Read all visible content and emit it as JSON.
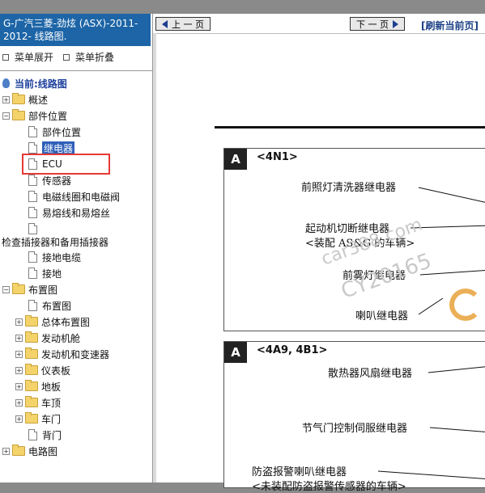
{
  "left_panel": {
    "title": "G-广汽三菱-劲炫 (ASX)-2011-2012- 线路图.",
    "expand_label": "菜单展开",
    "collapse_label": "菜单折叠",
    "current_label": "当前:线路图",
    "tree": {
      "n1": "概述",
      "n2": "部件位置",
      "n3": "部件位置",
      "n4": "继电器",
      "n5": "ECU",
      "n6": "传感器",
      "n7": "电磁线圈和电磁阀",
      "n8": "易熔线和易熔丝",
      "n9": "检查插接器和备用插接器",
      "n10": "接地电缆",
      "n11": "接地",
      "n12": "布置图",
      "n13": "布置图",
      "n14": "总体布置图",
      "n15": "发动机舱",
      "n16": "发动机和变速器",
      "n17": "仪表板",
      "n18": "地板",
      "n19": "车顶",
      "n20": "车门",
      "n21": "背门",
      "n22": "电路图"
    }
  },
  "toolbar": {
    "prev_label": "上 一 页",
    "next_label": "下 一 页",
    "refresh_label": "[刷新当前页]"
  },
  "content": {
    "panel1": {
      "tag": "A",
      "code": "<4N1>",
      "labels": {
        "l1": "前照灯清洗器继电器",
        "l2": "起动机切断继电器",
        "l3": "<装配 AS&G 的车辆>",
        "l4": "前雾灯继电器",
        "l5": "喇叭继电器"
      }
    },
    "panel2": {
      "tag": "A",
      "code": "<4A9, 4B1>",
      "labels": {
        "l1": "散热器风扇继电器",
        "l2": "节气门控制伺服继电器",
        "l3": "防盗报警喇叭继电器",
        "l4": "<未装配防盗报警传感器的车辆>"
      }
    },
    "watermark": {
      "w1": "car388.com",
      "w2": "CY20165"
    }
  }
}
